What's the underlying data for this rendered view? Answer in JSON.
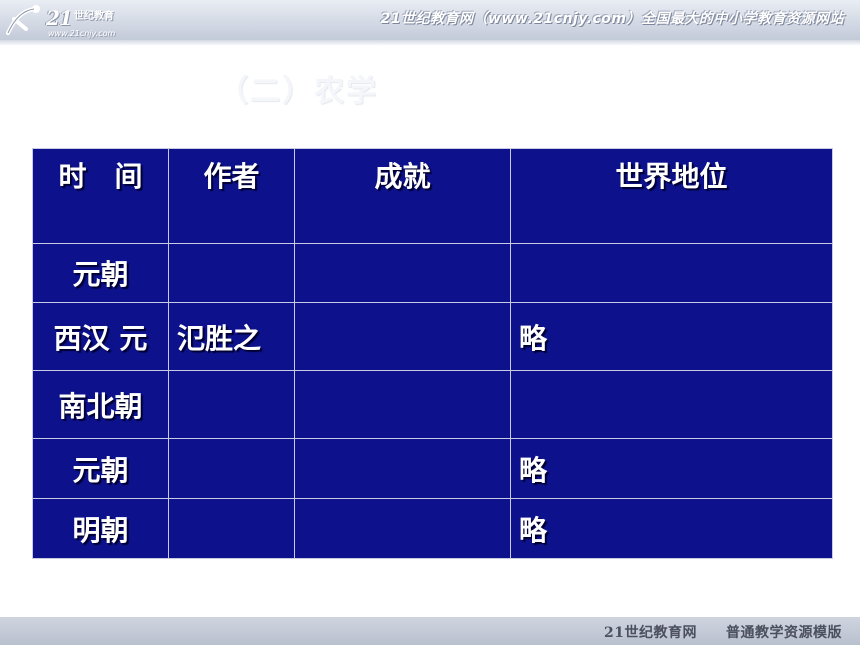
{
  "header": {
    "logo_text": "21",
    "logo_sub": "世纪教育",
    "logo_url": "www.21cnjy.com",
    "slogan": "21世纪教育网（www.21cnjy.com）全国最大的中小学教育资源网站"
  },
  "section": {
    "heading": "（二）农学"
  },
  "table": {
    "headers": [
      "时　间",
      "作者",
      "成就",
      "世界地位"
    ],
    "rows": [
      [
        "元朝",
        "",
        "",
        ""
      ],
      [
        "西汉 元",
        "氾胜之",
        "",
        "略"
      ],
      [
        "南北朝",
        "",
        "",
        ""
      ],
      [
        "元朝",
        "",
        "",
        "略"
      ],
      [
        "明朝",
        "",
        "",
        "略"
      ]
    ]
  },
  "footer": {
    "text": "21世纪教育网　　普通教学资源模版"
  },
  "colors": {
    "table_bg": "#0d128c",
    "header_band": "#c3cad8"
  }
}
